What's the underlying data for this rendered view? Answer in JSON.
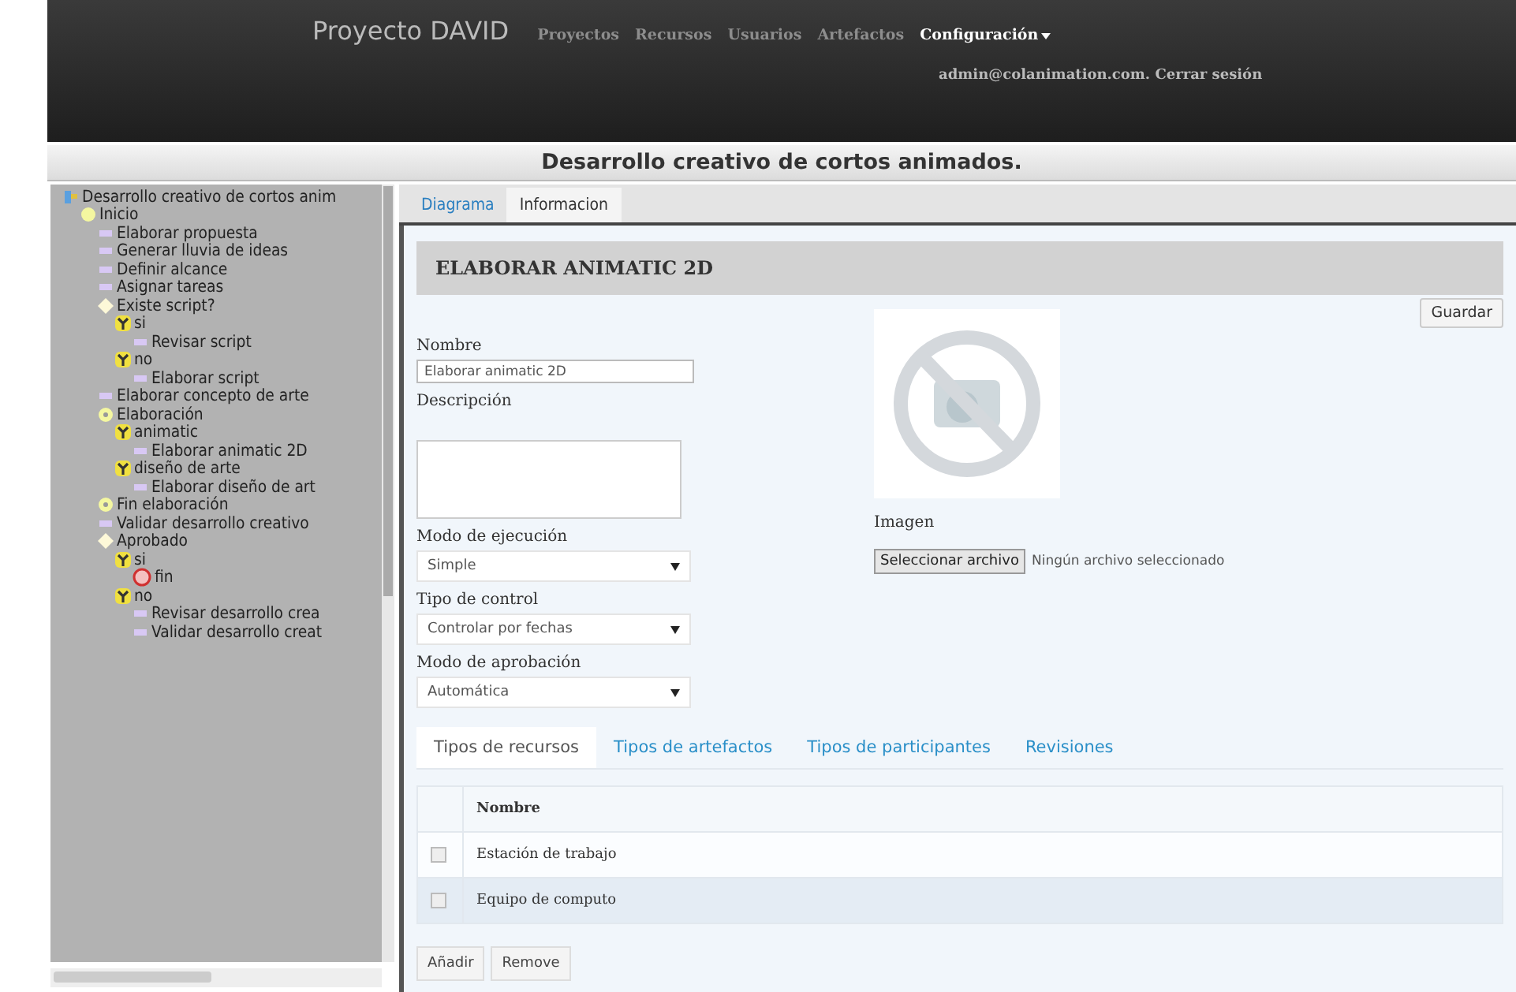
{
  "header": {
    "brand": "Proyecto DAVID",
    "nav": [
      {
        "label": "Proyectos",
        "selected": false
      },
      {
        "label": "Recursos",
        "selected": false
      },
      {
        "label": "Usuarios",
        "selected": false
      },
      {
        "label": "Artefactos",
        "selected": false
      },
      {
        "label": "Configuración",
        "selected": true,
        "dropdown": true
      }
    ],
    "user": "admin@colanimation.com.",
    "logout": "Cerrar sesión"
  },
  "page_title": "Desarrollo creativo de cortos animados.",
  "tree": [
    {
      "kind": "root",
      "label": "Desarrollo creativo de cortos anim",
      "children": [
        {
          "kind": "start",
          "label": "Inicio",
          "children": [
            {
              "kind": "task",
              "label": "Elaborar propuesta"
            },
            {
              "kind": "task",
              "label": "Generar lluvia de ideas"
            },
            {
              "kind": "task",
              "label": "Definir alcance"
            },
            {
              "kind": "task",
              "label": "Asignar tareas"
            },
            {
              "kind": "decision",
              "label": "Existe script?",
              "children": [
                {
                  "kind": "branch",
                  "label": "si",
                  "children": [
                    {
                      "kind": "task",
                      "label": "Revisar script"
                    }
                  ]
                },
                {
                  "kind": "branch",
                  "label": "no",
                  "children": [
                    {
                      "kind": "task",
                      "label": "Elaborar script"
                    }
                  ]
                }
              ]
            },
            {
              "kind": "task",
              "label": "Elaborar concepto de arte"
            },
            {
              "kind": "gateway",
              "label": "Elaboración",
              "children": [
                {
                  "kind": "branch",
                  "label": "animatic",
                  "children": [
                    {
                      "kind": "task",
                      "label": "Elaborar animatic 2D"
                    }
                  ]
                },
                {
                  "kind": "branch",
                  "label": "diseño de arte",
                  "children": [
                    {
                      "kind": "task",
                      "label": "Elaborar diseño de art"
                    }
                  ]
                }
              ]
            },
            {
              "kind": "gateway",
              "label": "Fin elaboración"
            },
            {
              "kind": "task",
              "label": "Validar desarrollo creativo"
            },
            {
              "kind": "decision",
              "label": "Aprobado",
              "children": [
                {
                  "kind": "branch",
                  "label": "si",
                  "children": [
                    {
                      "kind": "end",
                      "label": "fin"
                    }
                  ]
                },
                {
                  "kind": "branch",
                  "label": "no",
                  "children": [
                    {
                      "kind": "task",
                      "label": "Revisar desarrollo crea"
                    },
                    {
                      "kind": "task",
                      "label": "Validar desarrollo creat"
                    }
                  ]
                }
              ]
            }
          ]
        }
      ]
    }
  ],
  "view_tabs": [
    {
      "label": "Diagrama",
      "selected": false
    },
    {
      "label": "Informacion",
      "selected": true
    }
  ],
  "detail": {
    "title": "ELABORAR ANIMATIC 2D",
    "save": "Guardar",
    "fields": [
      {
        "kind": "text",
        "label": "Nombre",
        "value": "Elaborar animatic 2D"
      },
      {
        "kind": "textarea",
        "label": "Descripción"
      },
      {
        "kind": "select",
        "label": "Modo de ejecución",
        "value": "Simple"
      },
      {
        "kind": "select",
        "label": "Tipo de control",
        "value": "Controlar por fechas"
      },
      {
        "kind": "select",
        "label": "Modo de aprobación",
        "value": "Automática"
      }
    ],
    "image": {
      "label": "Imagen",
      "button": "Seleccionar archivo",
      "status": "Ningún archivo seleccionado"
    },
    "tabs": [
      {
        "label": "Tipos de recursos",
        "selected": true
      },
      {
        "label": "Tipos de artefactos",
        "selected": false
      },
      {
        "label": "Tipos de participantes",
        "selected": false
      },
      {
        "label": "Revisiones",
        "selected": false
      }
    ],
    "table": {
      "columns": [
        "Nombre"
      ],
      "rows": [
        {
          "name": "Estación de trabajo",
          "checked": false,
          "selected": false
        },
        {
          "name": "Equipo de computo",
          "checked": false,
          "selected": true
        }
      ]
    },
    "buttons": [
      "Añadir",
      "Remove"
    ]
  }
}
